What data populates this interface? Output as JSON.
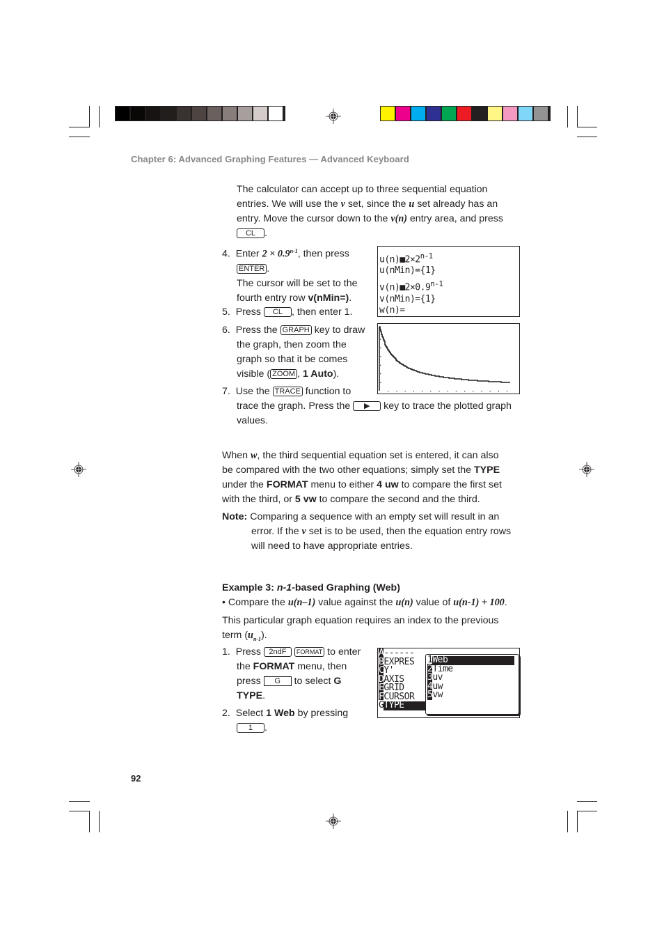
{
  "print_marks": {
    "gray_swatches": [
      "#000000",
      "#0a0806",
      "#161312",
      "#221e1c",
      "#3a3230",
      "#4e4543",
      "#6a605d",
      "#877e7b",
      "#a69f9d",
      "#d3cccb",
      "#ffffff"
    ],
    "color_swatches": [
      "#fff200",
      "#ec008c",
      "#00aeef",
      "#2e3192",
      "#00a651",
      "#ed1c24",
      "#231f20",
      "#fff685",
      "#f49ac1",
      "#7fd6f7",
      "#939393"
    ]
  },
  "header": {
    "title": "Chapter 6: Advanced Graphing Features — Advanced Keyboard"
  },
  "intro": {
    "line1": "The calculator can accept up to three sequential equation",
    "line2a": "entries. We will use the ",
    "line2v": "v",
    "line2b": " set, since the ",
    "line2u": "u",
    "line2c": " set already has an",
    "line3a": "entry. Move the cursor down to the ",
    "line3v": "v(n)",
    "line3b": " entry area, and press",
    "key_cl": "CL",
    "end": "."
  },
  "steps_a": [
    {
      "num": "4.",
      "text_a": "Enter ",
      "formula": "2 × 0.9",
      "sup": "n-1",
      "text_b": ", then press",
      "key": "ENTER",
      "l3": "The cursor will be set to the",
      "l4a": "fourth entry row ",
      "l4b": "v(nMin=)",
      "l4c": "."
    },
    {
      "num": "5.",
      "text_a": "Press ",
      "key": "CL",
      "text_b": ", then enter 1."
    },
    {
      "num": "6.",
      "text_a": "Press the ",
      "key": "GRAPH",
      "text_b": " key to draw",
      "l2": "the graph, then zoom the",
      "l3": "graph so that it be comes",
      "l4a": "visible (",
      "l4key": "ZOOM",
      "l4b": ", ",
      "l4bold": "1 Auto",
      "l4c": ")."
    },
    {
      "num": "7.",
      "text_a": "Use the ",
      "key": "TRACE",
      "text_b": " function to",
      "l2a": "trace the graph. Press the ",
      "l2key": "▶",
      "l2b": " key to trace the plotted graph",
      "l3": "values."
    }
  ],
  "screen1": {
    "lines": [
      {
        "pre": "u(n)",
        "mark": "■",
        "expr": "2×2",
        "sup": "n-1"
      },
      {
        "pre": "u(nMin)={1}"
      },
      {
        "pre": "v(n)",
        "mark": "■",
        "expr": "2×0.9",
        "sup": "n-1"
      },
      {
        "pre": "v(nMin)={1}"
      },
      {
        "pre": "w(n)="
      }
    ]
  },
  "screen2": {
    "description": "decaying curve of 2×0.9^(n-1) with tick marks on axes"
  },
  "para_w": {
    "l1a": "When ",
    "l1w": "w",
    "l1b": ", the third sequential equation set is entered, it can also",
    "l2a": "be compared with the two other equations; simply set the ",
    "l2b": "TYPE",
    "l3a": "under the ",
    "l3b": "FORMAT",
    "l3c": " menu to either ",
    "l3d": "4 uw",
    "l3e": " to compare the first set",
    "l4a": "with the third, or ",
    "l4b": "5 vw",
    "l4c": " to compare the second and the third."
  },
  "note": {
    "label": "Note:",
    "l1": " Comparing a sequence with an empty set will result in an",
    "l2a": "error. If the ",
    "l2v": "v",
    "l2b": " set is to be used, then the equation entry rows",
    "l3": "will need to have appropriate entries."
  },
  "example3": {
    "title_a": "Example 3: ",
    "title_it": "n-1",
    "title_b": "-based Graphing (Web)",
    "bullet_a": "• Compare the ",
    "bullet_f1": "u(n–1)",
    "bullet_b": " value against the ",
    "bullet_f2": "u(n)",
    "bullet_c": " value of ",
    "bullet_f3": "u(n-1) + 100",
    "bullet_d": ".",
    "p1": "This particular graph equation requires an index to the previous",
    "p2a": "term (",
    "p2u": "u",
    "p2sub": "n-1",
    "p2b": ")."
  },
  "steps_b": [
    {
      "num": "1.",
      "a": "Press ",
      "key1": "2ndF",
      "key2": "FORMAT",
      "b": " to enter",
      "l2a": "the ",
      "l2b": "FORMAT",
      "l2c": " menu, then",
      "l3a": "press ",
      "l3key": "G",
      "l3b": " to select ",
      "l3c": "G",
      "l4": "TYPE",
      "l4end": "."
    },
    {
      "num": "2.",
      "a": "Select ",
      "bold": "1 Web",
      "b": " by pressing",
      "key": "1",
      "end": "."
    }
  ],
  "screen3": {
    "left_items": [
      {
        "letter": "A",
        "label": "------"
      },
      {
        "letter": "B",
        "label": "EXPRES"
      },
      {
        "letter": "C",
        "label": "Y'"
      },
      {
        "letter": "D",
        "label": "AXIS"
      },
      {
        "letter": "E",
        "label": "GRID"
      },
      {
        "letter": "F",
        "label": "CURSOR"
      },
      {
        "letter": "G",
        "label": "TYPE"
      }
    ],
    "menu_items": [
      {
        "num": "1",
        "label": "Web"
      },
      {
        "num": "2",
        "label": "Time"
      },
      {
        "num": "3",
        "label": "uv"
      },
      {
        "num": "4",
        "label": "uw"
      },
      {
        "num": "5",
        "label": "vw"
      }
    ]
  },
  "page_number": "92"
}
